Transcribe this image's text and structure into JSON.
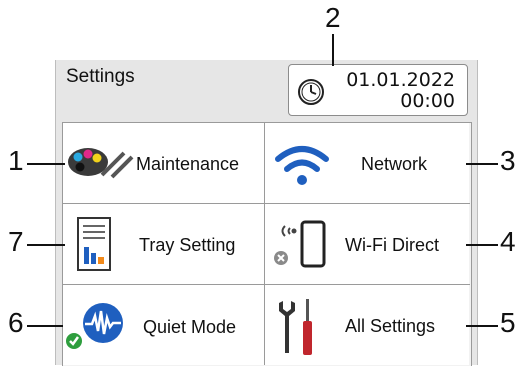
{
  "header": {
    "title": "Settings"
  },
  "datetime": {
    "date": "01.01.2022",
    "time": "00:00"
  },
  "tiles": {
    "maintenance": {
      "label": "Maintenance"
    },
    "network": {
      "label": "Network"
    },
    "tray_setting": {
      "label": "Tray Setting"
    },
    "wifi_direct": {
      "label": "Wi-Fi Direct"
    },
    "quiet_mode": {
      "label": "Quiet Mode"
    },
    "all_settings": {
      "label": "All Settings"
    }
  },
  "callouts": [
    "1",
    "2",
    "3",
    "4",
    "5",
    "6",
    "7"
  ],
  "colors": {
    "wifi_blue": "#1f5fbf",
    "quiet_check": "#2e9e3e",
    "screwdriver_red": "#c0262d"
  },
  "icons": [
    "clock-icon",
    "ink-palette-icon",
    "wifi-icon",
    "tray-report-icon",
    "wifi-direct-phone-icon",
    "quiet-wave-icon",
    "tools-icon"
  ]
}
